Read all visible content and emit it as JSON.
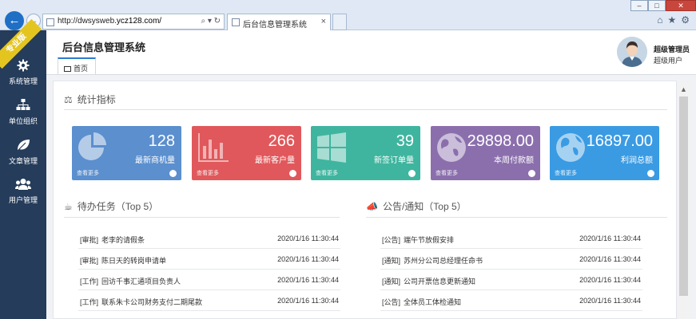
{
  "browser": {
    "url_prefix": "http://dwsysweb.",
    "url_domain": "ycz128.com/",
    "url_tools": "⌕ ▾ ↻",
    "tab_title": "后台信息管理系统",
    "tab_close": "×",
    "back": "←",
    "forward": "→",
    "minimize": "–",
    "maximize": "□",
    "close": "✕",
    "home": "⌂",
    "favorites": "★",
    "settings": "⚙"
  },
  "sidebar": {
    "badge": "专业版",
    "items": [
      {
        "label": "系统管理",
        "icon": "gear-icon"
      },
      {
        "label": "单位组织",
        "icon": "org-chart-icon"
      },
      {
        "label": "文章管理",
        "icon": "leaf-icon"
      },
      {
        "label": "用户管理",
        "icon": "users-icon"
      }
    ]
  },
  "header": {
    "title": "后台信息管理系统",
    "home_tab": "首页",
    "user_name": "超级管理员",
    "user_role": "超级用户"
  },
  "stats": {
    "title": "统计指标",
    "more_label": "查看更多",
    "cards": [
      {
        "value": "128",
        "label": "最新商机量",
        "color": "#5b8fce",
        "icon": "pie-chart-icon"
      },
      {
        "value": "266",
        "label": "最新客户量",
        "color": "#e0585b",
        "icon": "bar-chart-icon"
      },
      {
        "value": "39",
        "label": "新签订单量",
        "color": "#3fb59f",
        "icon": "windows-icon"
      },
      {
        "value": "29898.00",
        "label": "本周付款额",
        "color": "#8b6fad",
        "icon": "globe-icon"
      },
      {
        "value": "16897.00",
        "label": "利润总额",
        "color": "#3a9be3",
        "icon": "globe-icon"
      }
    ]
  },
  "todo": {
    "title": "待办任务（Top 5）",
    "rows": [
      {
        "tag": "[审批]",
        "text": "老李的请假条",
        "time": "2020/1/16 11:30:44"
      },
      {
        "tag": "[审批]",
        "text": "陈日天的转岗申请单",
        "time": "2020/1/16 11:30:44"
      },
      {
        "tag": "[工作]",
        "text": "回访千事汇通项目负责人",
        "time": "2020/1/16 11:30:44"
      },
      {
        "tag": "[工作]",
        "text": "联系朱卡公司财务支付二期尾款",
        "time": "2020/1/16 11:30:44"
      }
    ]
  },
  "notices": {
    "title": "公告/通知（Top 5）",
    "rows": [
      {
        "tag": "[公告]",
        "text": "端午节放假安排",
        "time": "2020/1/16 11:30:44"
      },
      {
        "tag": "[通知]",
        "text": "苏州分公司总经理任命书",
        "time": "2020/1/16 11:30:44"
      },
      {
        "tag": "[通知]",
        "text": "公司开票信息更新通知",
        "time": "2020/1/16 11:30:44"
      },
      {
        "tag": "[公告]",
        "text": "全体员工体检通知",
        "time": "2020/1/16 11:30:44"
      }
    ]
  }
}
